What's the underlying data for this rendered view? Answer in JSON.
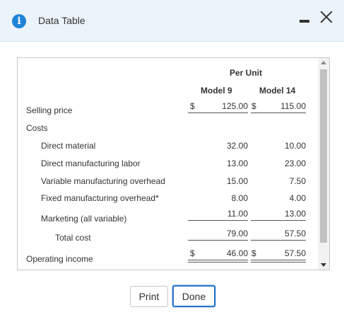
{
  "window": {
    "title": "Data Table"
  },
  "table": {
    "group_header": "Per Unit",
    "col_headers": [
      "Model 9",
      "Model 14"
    ],
    "rows": {
      "selling_price": {
        "label": "Selling price",
        "cur9": "$",
        "m9": "125.00",
        "cur14": "$",
        "m14": "115.00"
      },
      "costs": {
        "label": "Costs"
      },
      "direct_material": {
        "label": "Direct material",
        "m9": "32.00",
        "m14": "10.00"
      },
      "direct_labor": {
        "label": "Direct manufacturing labor",
        "m9": "13.00",
        "m14": "23.00"
      },
      "var_overhead": {
        "label": "Variable manufacturing overhead",
        "m9": "15.00",
        "m14": "7.50"
      },
      "fixed_overhead": {
        "label": "Fixed manufacturing overhead*",
        "m9": "8.00",
        "m14": "4.00"
      },
      "marketing": {
        "label": "Marketing (all variable)",
        "m9": "11.00",
        "m14": "13.00"
      },
      "total_cost": {
        "label": "Total cost",
        "m9": "79.00",
        "m14": "57.50"
      },
      "operating_income": {
        "label": "Operating income",
        "cur9": "$",
        "m9": "46.00",
        "cur14": "$",
        "m14": "57.50"
      }
    }
  },
  "buttons": {
    "print": "Print",
    "done": "Done"
  }
}
